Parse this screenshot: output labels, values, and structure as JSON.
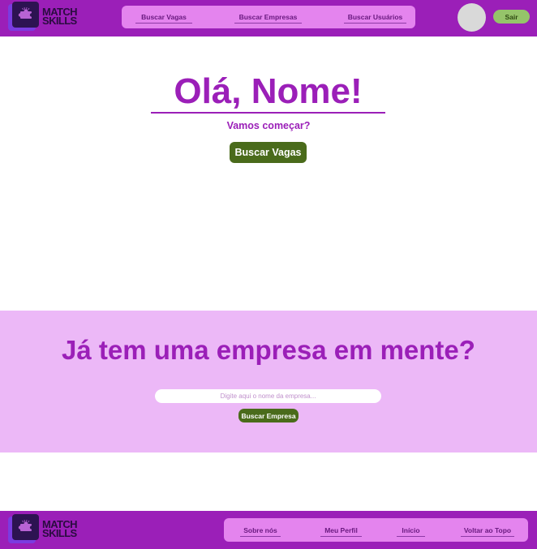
{
  "header": {
    "logo": {
      "line1": "MATCH",
      "line2": "SKILLS",
      "icon": "puzzle-icon"
    },
    "nav": [
      {
        "label": "Buscar Vagas"
      },
      {
        "label": "Buscar Empresas"
      },
      {
        "label": "Buscar Usuários"
      }
    ],
    "logout_label": "Sair"
  },
  "hero": {
    "title": "Olá, Nome!",
    "subtitle": "Vamos começar?",
    "button_label": "Buscar Vagas"
  },
  "company_search": {
    "title": "Já tem uma empresa em mente?",
    "placeholder": "Digite aqui o nome da empresa...",
    "button_label": "Buscar Empresa"
  },
  "footer": {
    "logo": {
      "line1": "MATCH",
      "line2": "SKILLS",
      "icon": "puzzle-icon"
    },
    "nav": [
      {
        "label": "Sobre nós"
      },
      {
        "label": "Meu Perfil"
      },
      {
        "label": "Início"
      },
      {
        "label": "Voltar ao Topo"
      }
    ]
  },
  "colors": {
    "primary_purple": "#9b1fb8",
    "nav_pink": "#e484ee",
    "band_pink": "#ecb8f7",
    "button_green": "#4a6b1b",
    "logout_green": "#95c46a"
  }
}
